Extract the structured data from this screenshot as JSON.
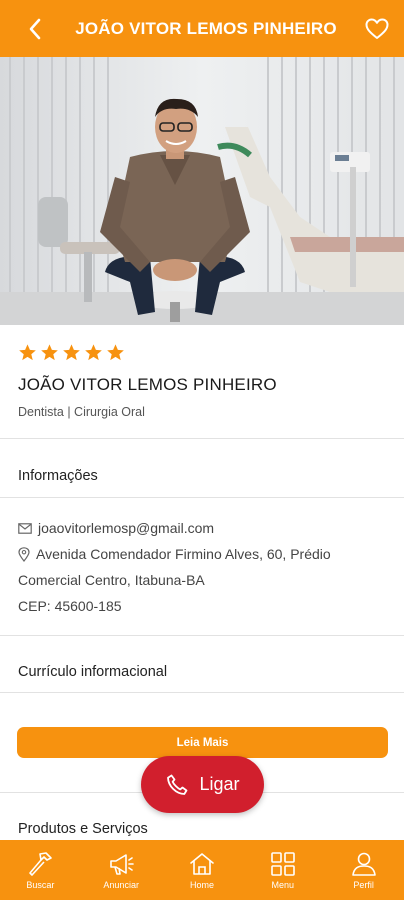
{
  "header": {
    "title": "JOÃO VITOR LEMOS PINHEIRO",
    "back_icon": "chevron-left-icon",
    "favorite_icon": "heart-outline-icon"
  },
  "colors": {
    "accent": "#f7920f",
    "call_button": "#d11f2d",
    "star": "#f7920f"
  },
  "profile": {
    "rating_stars": 5,
    "rating_max": 5,
    "name": "JOÃO VITOR LEMOS PINHEIRO",
    "specialty": "Dentista | Cirurgia Oral"
  },
  "sections": {
    "info_title": "Informações",
    "curriculum_title": "Currículo informacional",
    "products_title": "Produtos e Serviços"
  },
  "info": {
    "email": "joaovitorlemosp@gmail.com",
    "address_line1": "Avenida Comendador Firmino Alves, 60, Prédio",
    "address_line2": "Comercial Centro, Itabuna-BA",
    "cep": "CEP: 45600-185"
  },
  "buttons": {
    "read_more": "Leia Mais",
    "call": "Ligar"
  },
  "bottom_nav": {
    "items": [
      {
        "label": "Buscar",
        "icon": "hammer-icon"
      },
      {
        "label": "Anunciar",
        "icon": "megaphone-icon"
      },
      {
        "label": "Home",
        "icon": "home-icon"
      },
      {
        "label": "Menu",
        "icon": "grid-icon"
      },
      {
        "label": "Perfil",
        "icon": "user-icon"
      }
    ]
  }
}
